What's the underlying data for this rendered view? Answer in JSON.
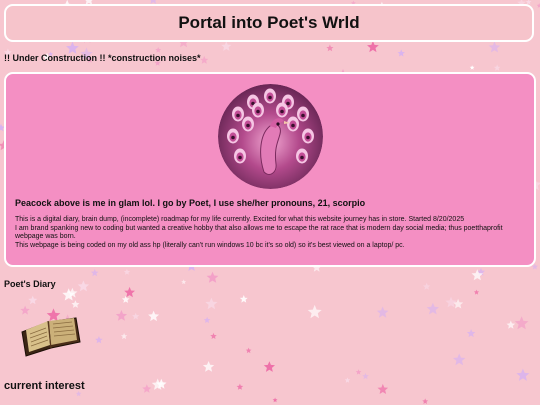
{
  "header": {
    "title": "Portal into Poet's Wrld"
  },
  "notice": {
    "text": "!! Under Construction !! *construction noises*"
  },
  "intro": {
    "avatar_icon": "peacock-portrait-icon",
    "heading": "Peacock above is me in glam lol. I go by Poet, I use she/her pronouns, 21, scorpio",
    "lines": [
      "This is a digital diary, brain dump, (incomplete) roadmap for my life currently. Excited for what this website journey has in store. Started 8/20/2025",
      "I am brand spanking new to coding but wanted a creative hobby that also allows me to escape the rat race that is modern day social media; thus poetthaprofit webpage was born.",
      "This webpage is being coded on my old ass hp (literally can't run windows 10 bc it's so old) so it's best viewed on a laptop/ pc."
    ]
  },
  "diary": {
    "label": "Poet's Diary",
    "icon": "open-book-icon"
  },
  "current_interest": {
    "label": "current interest"
  },
  "colors": {
    "background": "#f7c6cf",
    "card": "#f48fc3",
    "header": "#f6c4cb",
    "border": "#ffffff"
  }
}
